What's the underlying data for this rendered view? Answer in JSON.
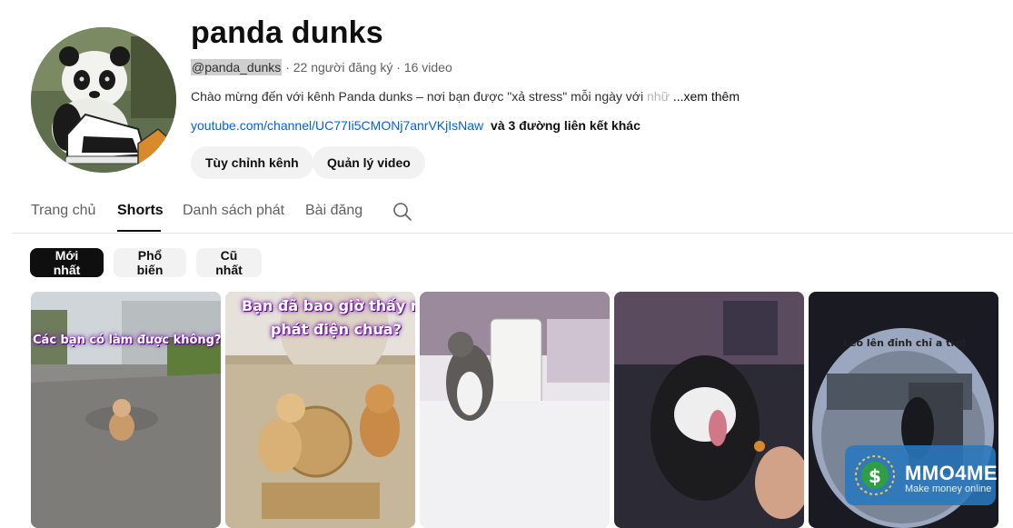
{
  "channel": {
    "name": "panda dunks",
    "handle": "@panda_dunks",
    "subscribers": "· 22 người đăng ký ·",
    "video_count": "16 video",
    "description": "Chào mừng đến với kênh Panda dunks – nơi bạn được \"xả stress\" mỗi ngày với",
    "description_fade": " nhữ",
    "more_label": "...xem thêm",
    "link_url": "youtube.com/channel/UC77Ii5CMONj7anrVKjIsNaw",
    "link_extra": "và 3 đường liên kết khác"
  },
  "actions": {
    "customize": "Tùy chỉnh kênh",
    "manage": "Quản lý video"
  },
  "tabs": [
    {
      "label": "Trang chủ",
      "active": false
    },
    {
      "label": "Shorts",
      "active": true
    },
    {
      "label": "Danh sách phát",
      "active": false
    },
    {
      "label": "Bài đăng",
      "active": false
    }
  ],
  "filters": [
    {
      "label": "Mới nhất",
      "active": true
    },
    {
      "label": "Phổ biến",
      "active": false
    },
    {
      "label": "Cũ nhất",
      "active": false
    }
  ],
  "shorts": [
    {
      "overlay": "Các bạn có làm được không?"
    },
    {
      "overlay_line1": "Bạn đã bao giờ thấy mèo",
      "overlay_line2": "phát điện chưa?"
    },
    {},
    {},
    {
      "overlay": "Leo lên đỉnh chỉ a trời"
    }
  ],
  "watermark": {
    "title": "MMO4ME",
    "subtitle": "Make money online"
  },
  "icons": {
    "search_tab": "search-icon",
    "watermark_logo": "dollar-coin-icon"
  }
}
